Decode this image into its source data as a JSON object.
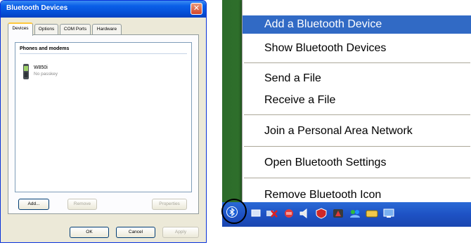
{
  "dialog": {
    "title": "Bluetooth Devices",
    "close_glyph": "✕",
    "tabs": [
      {
        "label": "Devices",
        "active": true
      },
      {
        "label": "Options",
        "active": false
      },
      {
        "label": "COM Ports",
        "active": false
      },
      {
        "label": "Hardware",
        "active": false
      }
    ],
    "group_header": "Phones and modems",
    "device": {
      "name": "W850i",
      "status": "No passkey",
      "icon": "mobile-phone-icon"
    },
    "buttons": {
      "add": "Add...",
      "remove": "Remove",
      "properties": "Properties",
      "ok": "OK",
      "cancel": "Cancel",
      "apply": "Apply"
    }
  },
  "context_menu": {
    "items": [
      {
        "label": "Add a Bluetooth Device",
        "highlighted": true
      },
      {
        "label": "Show Bluetooth Devices"
      },
      {
        "label": "Send a File"
      },
      {
        "label": "Receive a File"
      },
      {
        "label": "Join a Personal Area Network"
      },
      {
        "label": "Open Bluetooth Settings"
      },
      {
        "label": "Remove Bluetooth Icon"
      }
    ]
  },
  "taskbar": {
    "tray_icons": [
      "bluetooth-icon",
      "network-icon",
      "network-disconnected-icon",
      "security-alert-icon",
      "speaker-icon",
      "shield-icon",
      "antivirus-icon",
      "messenger-icon",
      "keyboard-icon",
      "display-icon"
    ]
  },
  "colors": {
    "xp_title_blue": "#0a5fe8",
    "menu_highlight": "#316ac5",
    "dialog_face": "#ece9d8",
    "taskbar_blue": "#1e52c4"
  }
}
